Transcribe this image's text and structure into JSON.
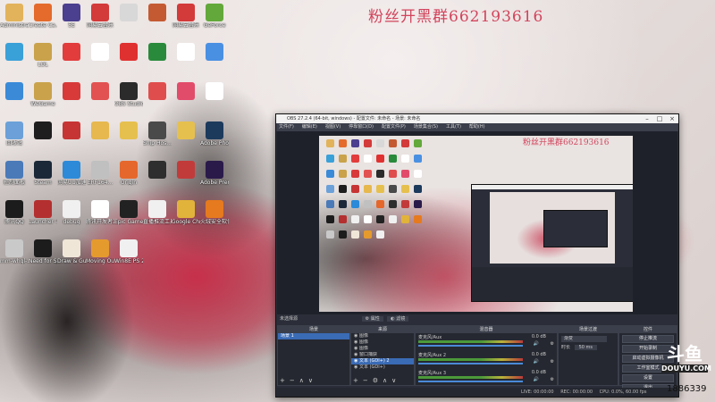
{
  "watermark": "粉丝开黑群662193616",
  "desktop_icons": [
    {
      "label": "Administrator",
      "color": "#e2b35a",
      "col": 0,
      "row": 0
    },
    {
      "label": "Create Ca...",
      "color": "#e46b2c",
      "col": 1,
      "row": 0
    },
    {
      "label": "5E",
      "color": "#4b3f8f",
      "col": 2,
      "row": 0
    },
    {
      "label": "网易云音乐",
      "color": "#d33a3a",
      "col": 3,
      "row": 0
    },
    {
      "label": "",
      "color": "#d8d8d8",
      "col": 4,
      "row": 0
    },
    {
      "label": "",
      "color": "#c45a32",
      "col": 5,
      "row": 0
    },
    {
      "label": "网易云音乐",
      "color": "#d33a3a",
      "col": 6,
      "row": 0
    },
    {
      "label": "GeForce",
      "color": "#63a83b",
      "col": 7,
      "row": 0
    },
    {
      "label": "",
      "color": "#3aa0d8",
      "col": 0,
      "row": 1
    },
    {
      "label": "LOL",
      "color": "#c9a24b",
      "col": 1,
      "row": 1
    },
    {
      "label": "",
      "color": "#e23c3c",
      "col": 2,
      "row": 1
    },
    {
      "label": "",
      "color": "#ffffff",
      "col": 3,
      "row": 1
    },
    {
      "label": "",
      "color": "#e03131",
      "col": 4,
      "row": 1
    },
    {
      "label": "",
      "color": "#2a8a3c",
      "col": 5,
      "row": 1
    },
    {
      "label": "",
      "color": "#ffffff",
      "col": 6,
      "row": 1
    },
    {
      "label": "",
      "color": "#4a90e2",
      "col": 7,
      "row": 1
    },
    {
      "label": "",
      "color": "#3a8ad8",
      "col": 0,
      "row": 2
    },
    {
      "label": "WeGame",
      "color": "#c9a24b",
      "col": 1,
      "row": 2
    },
    {
      "label": "",
      "color": "#d83a3a",
      "col": 2,
      "row": 2
    },
    {
      "label": "",
      "color": "#e25252",
      "col": 3,
      "row": 2
    },
    {
      "label": "OBS Studio",
      "color": "#2b2b2b",
      "col": 4,
      "row": 2
    },
    {
      "label": "",
      "color": "#e04d4d",
      "col": 5,
      "row": 2
    },
    {
      "label": "",
      "color": "#e24c6b",
      "col": 6,
      "row": 2
    },
    {
      "label": "",
      "color": "#ffffff",
      "col": 7,
      "row": 2
    },
    {
      "label": "回收站",
      "color": "#6ba1d8",
      "col": 0,
      "row": 3
    },
    {
      "label": "",
      "color": "#1e1e1e",
      "col": 1,
      "row": 3
    },
    {
      "label": "",
      "color": "#c73434",
      "col": 2,
      "row": 3
    },
    {
      "label": "",
      "color": "#e6b84e",
      "col": 3,
      "row": 3
    },
    {
      "label": "",
      "color": "#e6c04e",
      "col": 4,
      "row": 3
    },
    {
      "label": "Snip Hos...",
      "color": "#4a4a4a",
      "col": 5,
      "row": 3
    },
    {
      "label": "",
      "color": "#e6c04e",
      "col": 6,
      "row": 3
    },
    {
      "label": "Adobe Photosh...",
      "color": "#1c3a5c",
      "col": 7,
      "row": 3
    },
    {
      "label": "控制面板",
      "color": "#4a7ab8",
      "col": 0,
      "row": 4
    },
    {
      "label": "Steam",
      "color": "#1b2838",
      "col": 1,
      "row": 4
    },
    {
      "label": "网易UU加速",
      "color": "#2c8ad8",
      "col": 2,
      "row": 4
    },
    {
      "label": "ERF164...",
      "color": "#c0c0c0",
      "col": 3,
      "row": 4
    },
    {
      "label": "Origin",
      "color": "#e5672c",
      "col": 4,
      "row": 4
    },
    {
      "label": "",
      "color": "#2e2e2e",
      "col": 5,
      "row": 4
    },
    {
      "label": "",
      "color": "#c23b3b",
      "col": 6,
      "row": 4
    },
    {
      "label": "Adobe Premiere",
      "color": "#2a1a4a",
      "col": 7,
      "row": 4
    },
    {
      "label": "腾讯QQ",
      "color": "#1c1c1c",
      "col": 0,
      "row": 5
    },
    {
      "label": "Launcher -快捷方式",
      "color": "#b42f2f",
      "col": 1,
      "row": 5
    },
    {
      "label": "debug",
      "color": "#f0f0f0",
      "col": 2,
      "row": 5
    },
    {
      "label": "腾讯开发者工具",
      "color": "#ffffff",
      "col": 3,
      "row": 5
    },
    {
      "label": "Epic Games Launcher",
      "color": "#222222",
      "col": 4,
      "row": 5
    },
    {
      "label": "直播推流工具-SUP...",
      "color": "#f0f0f0",
      "col": 5,
      "row": 5
    },
    {
      "label": "Google Chrome",
      "color": "#e2b33a",
      "col": 6,
      "row": 5
    },
    {
      "label": "火绒安全软件",
      "color": "#e57a1e",
      "col": 7,
      "row": 5
    },
    {
      "label": "mm-whql-...",
      "color": "#c9c9c9",
      "col": 0,
      "row": 6
    },
    {
      "label": "Need for Speed™ ...",
      "color": "#1c1c1c",
      "col": 1,
      "row": 6
    },
    {
      "label": "Draw & Guess",
      "color": "#f0e6d8",
      "col": 2,
      "row": 6
    },
    {
      "label": "Moving Out",
      "color": "#e59a2e",
      "col": 3,
      "row": 6
    },
    {
      "label": "Win8E PS 2020 [以...",
      "color": "#f0f0f0",
      "col": 4,
      "row": 6
    }
  ],
  "obs": {
    "title": "OBS 27.2.4 (64-bit, windows) - 配置文件: 未命名 - 场景: 未命名",
    "menu": [
      "文件(F)",
      "编辑(E)",
      "视图(V)",
      "停靠窗口(D)",
      "配置文件(P)",
      "场景集合(S)",
      "工具(T)",
      "帮助(H)"
    ],
    "preview_watermark": "粉丝开黑群662193616",
    "scene_bar": {
      "label": "未选择源",
      "props": "属性",
      "filters": "滤镜"
    },
    "scenes": {
      "title": "场景",
      "items": [
        "场景 1"
      ]
    },
    "sources": {
      "title": "来源",
      "items": [
        "图像",
        "图像",
        "图像",
        "窗口捕获",
        "文本 (GDI+) 2",
        "文本 (GDI+)"
      ]
    },
    "mixer": {
      "title": "混音器",
      "channels": [
        {
          "name": "麦克风/Aux",
          "db": "0.0 dB"
        },
        {
          "name": "麦克风/Aux 2",
          "db": "0.0 dB"
        },
        {
          "name": "麦克风/Aux 3",
          "db": "0.0 dB"
        }
      ]
    },
    "transitions": {
      "title": "场景过渡",
      "type": "渐变",
      "duration_label": "时长",
      "duration": "50 ms"
    },
    "controls": {
      "title": "控件",
      "buttons": [
        "停止推流",
        "开始录制",
        "启动虚拟摄像机",
        "工作室模式",
        "设置",
        "退出"
      ]
    },
    "status": {
      "live_label": "LIVE:",
      "live_time": "00:00:00",
      "rec_label": "REC:",
      "rec_time": "00:00:00",
      "cpu": "CPU: 0.0%, 60.00 fps"
    }
  },
  "douyu": {
    "logo": "斗鱼",
    "domain": "DOUYU.COM",
    "room": "1886339"
  }
}
